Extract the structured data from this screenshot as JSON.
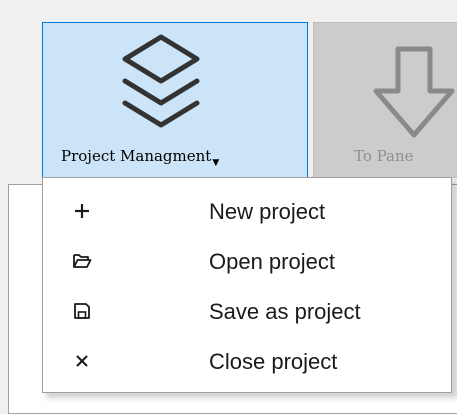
{
  "toolbar": {
    "project_button": {
      "label": "Project Managment",
      "icon": "layers-icon",
      "state": "pressed"
    },
    "panel_button": {
      "label": "To Pane",
      "icon": "arrow-down-icon",
      "state": "disabled"
    }
  },
  "menu": {
    "items": [
      {
        "label": "New project",
        "icon": "plus-icon"
      },
      {
        "label": "Open project",
        "icon": "folder-open-icon"
      },
      {
        "label": "Save as project",
        "icon": "save-icon"
      },
      {
        "label": "Close project",
        "icon": "close-icon"
      }
    ]
  },
  "colors": {
    "accent_border": "#0078d7",
    "pressed_background": "#cce4f7",
    "disabled_background": "#cccccc"
  }
}
